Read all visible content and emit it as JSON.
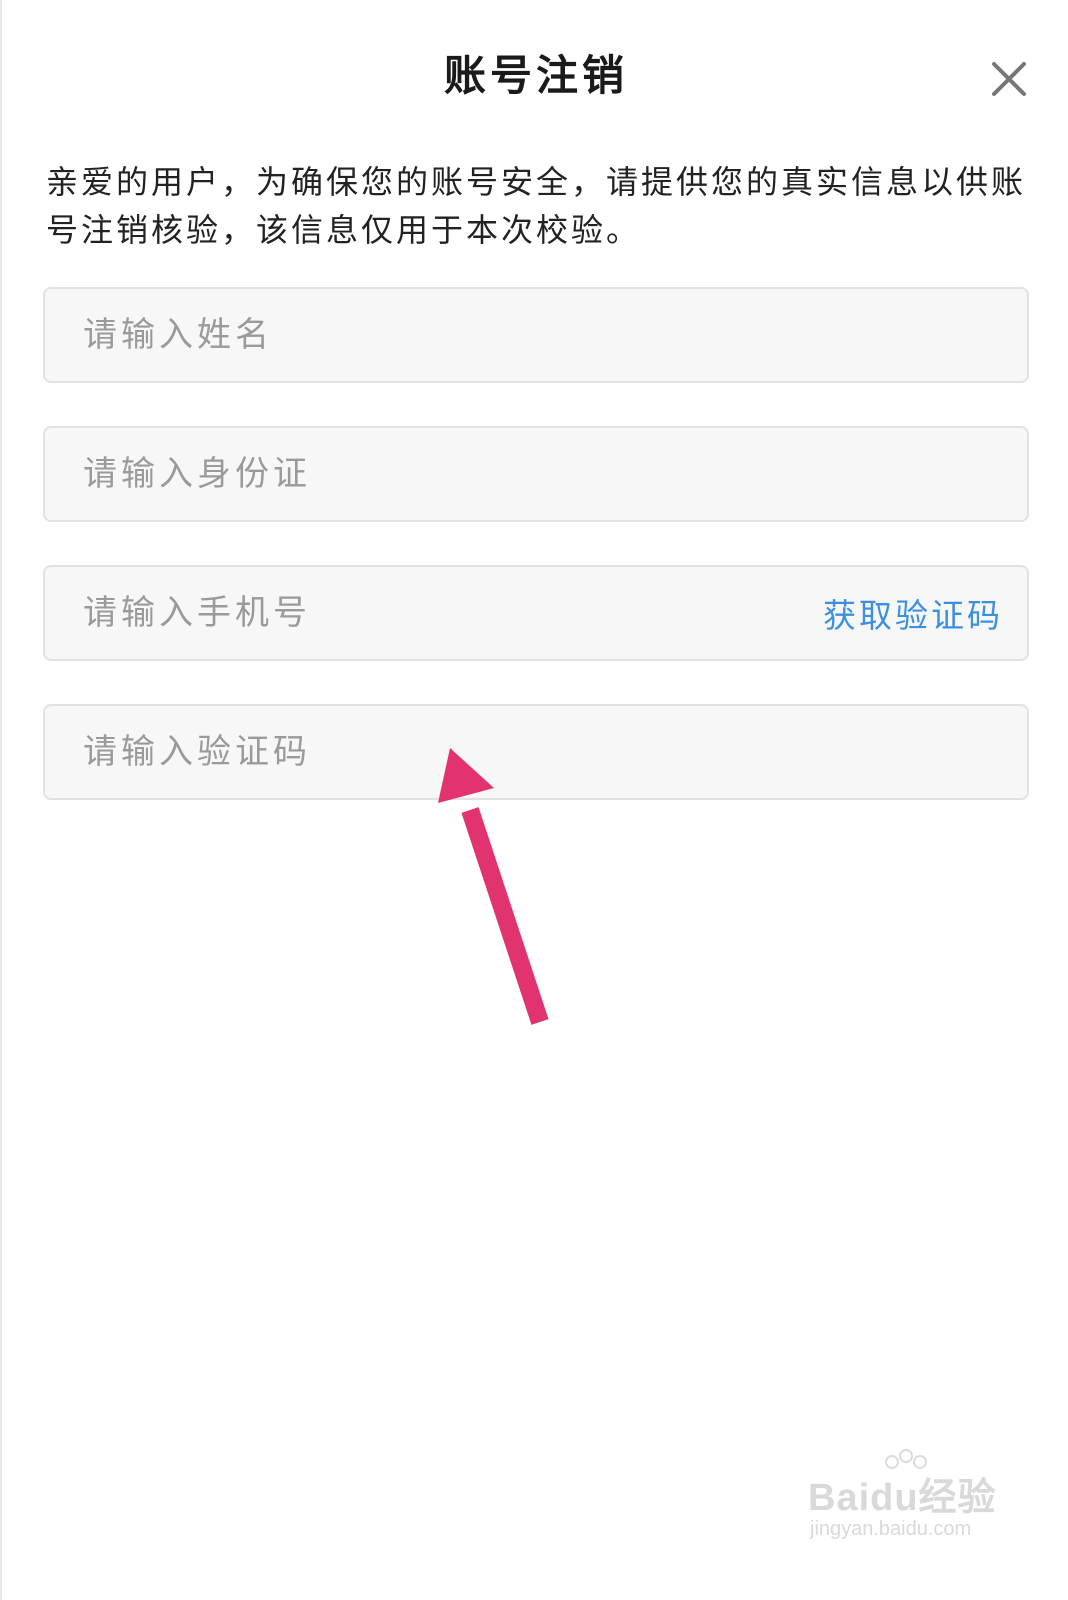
{
  "dialog": {
    "title": "账号注销",
    "intro": "亲爱的用户，为确保您的账号安全，请提供您的真实信息以供账号注销核验，该信息仅用于本次校验。"
  },
  "form": {
    "name_placeholder": "请输入姓名",
    "id_placeholder": "请输入身份证",
    "phone_placeholder": "请输入手机号",
    "get_code_label": "获取验证码",
    "code_placeholder": "请输入验证码"
  },
  "icons": {
    "close": "close-icon",
    "annotation": "arrow-up-icon"
  },
  "colors": {
    "link": "#3d8fe0",
    "annotation_arrow": "#e0336f"
  },
  "watermark": {
    "logo_text": "Baidu经验",
    "url": "jingyan.baidu.com"
  }
}
